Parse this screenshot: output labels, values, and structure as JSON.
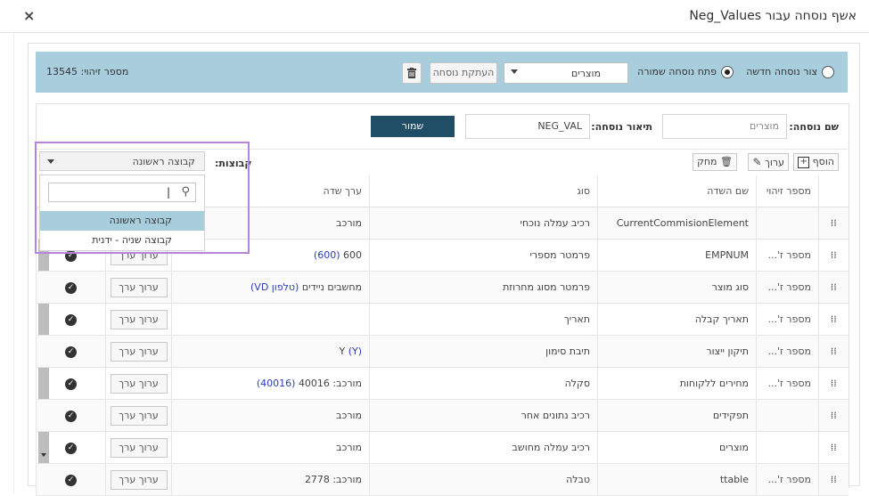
{
  "dialog": {
    "title": "אשף נוסחה עבור Neg_Values",
    "close_symbol": "×"
  },
  "top_bar": {
    "radio_new": "צור נוסחה חדשה",
    "radio_open": "פתח נוסחה שמורה",
    "formula_select_value": "מוצרים",
    "copy_button": "העתקת נוסחה",
    "id_label": "מספר זיהוי: 13545"
  },
  "form": {
    "name_label": "שם נוסחה:",
    "name_value": "מוצרים",
    "desc_label": "תיאור נוסחה:",
    "desc_value": "NEG_VAL",
    "save_button": "שמור"
  },
  "toolbar": {
    "add": "הוסף",
    "edit": "ערוך",
    "delete": "מחק",
    "groups_label": "קבוצות:",
    "group_selected": "קבוצה ראשונה"
  },
  "dropdown": {
    "search_value": "",
    "items": [
      "קבוצה ראשונה",
      "קבוצה שניה - ידנית"
    ]
  },
  "table": {
    "headers": [
      "מספר זיהוי",
      "שם השדה",
      "סוג",
      "ערך שדה"
    ],
    "value_button": "ערוך ערך",
    "rows": [
      {
        "id": "",
        "field": "CurrentCommisionElement",
        "type": "רכיב עמלה נוכחי",
        "value": "מורכב",
        "value_link": ""
      },
      {
        "id": "מספר ז'...",
        "field": "EMPNUM",
        "type": "פרמטר מספרי",
        "value": "600",
        "value_link": "(600)"
      },
      {
        "id": "מספר ז'...",
        "field": "סוג מוצר",
        "type": "פרמטר מסוג מחרוזת",
        "value": "מחשבים ניידים",
        "value_link": "(טלפון VD)"
      },
      {
        "id": "מספר ז'...",
        "field": "תאריך קבלה",
        "type": "תאריך",
        "value": "",
        "value_link": ""
      },
      {
        "id": "מספר ז'...",
        "field": "תיקון ייצור",
        "type": "תיבת סימון",
        "value": "Y",
        "value_link": "(Y)"
      },
      {
        "id": "מספר ז'...",
        "field": "מחירים ללקוחות",
        "type": "סקלה",
        "value": "מורכב: 40016",
        "value_link": "(40016)"
      },
      {
        "id": "",
        "field": "תפקידים",
        "type": "רכיב נתונים אחר",
        "value": "מורכב",
        "value_link": ""
      },
      {
        "id": "",
        "field": "מוצרים",
        "type": "רכיב עמלה מחושב",
        "value": "מורכב",
        "value_link": ""
      },
      {
        "id": "מספר ז'...",
        "field": "ttable",
        "type": "טבלה",
        "value": "מורכב: 2778",
        "value_link": ""
      }
    ]
  }
}
